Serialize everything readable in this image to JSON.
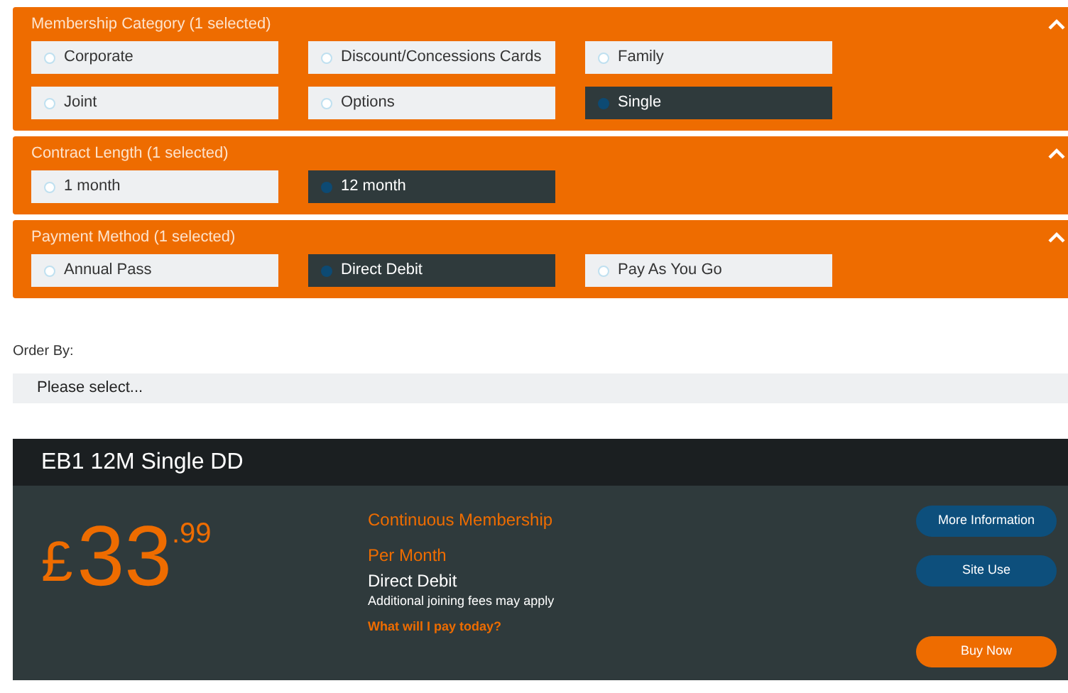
{
  "filters": [
    {
      "title": "Membership Category (1 selected)",
      "expanded": true,
      "options": [
        {
          "label": "Corporate",
          "selected": false
        },
        {
          "label": "Discount/Concessions Cards",
          "selected": false
        },
        {
          "label": "Family",
          "selected": false
        },
        {
          "label": "Joint",
          "selected": false
        },
        {
          "label": "Options",
          "selected": false
        },
        {
          "label": "Single",
          "selected": true
        }
      ]
    },
    {
      "title": "Contract Length (1 selected)",
      "expanded": true,
      "options": [
        {
          "label": "1 month",
          "selected": false
        },
        {
          "label": "12 month",
          "selected": true
        }
      ]
    },
    {
      "title": "Payment Method (1 selected)",
      "expanded": true,
      "options": [
        {
          "label": "Annual Pass",
          "selected": false
        },
        {
          "label": "Direct Debit",
          "selected": true
        },
        {
          "label": "Pay As You Go",
          "selected": false
        }
      ]
    }
  ],
  "order_by": {
    "label": "Order By:",
    "placeholder": "Please select..."
  },
  "product": {
    "title": "EB1 12M Single DD",
    "currency": "£",
    "price_whole": "33",
    "price_fraction": ".99",
    "type": "Continuous Membership",
    "period": "Per Month",
    "payment": "Direct Debit",
    "note": "Additional joining fees may apply",
    "link": "What will I pay today?",
    "buttons": [
      {
        "label": "More Information",
        "kind": "secondary"
      },
      {
        "label": "Site Use",
        "kind": "secondary"
      },
      {
        "label": "Buy Now",
        "kind": "primary"
      }
    ]
  }
}
